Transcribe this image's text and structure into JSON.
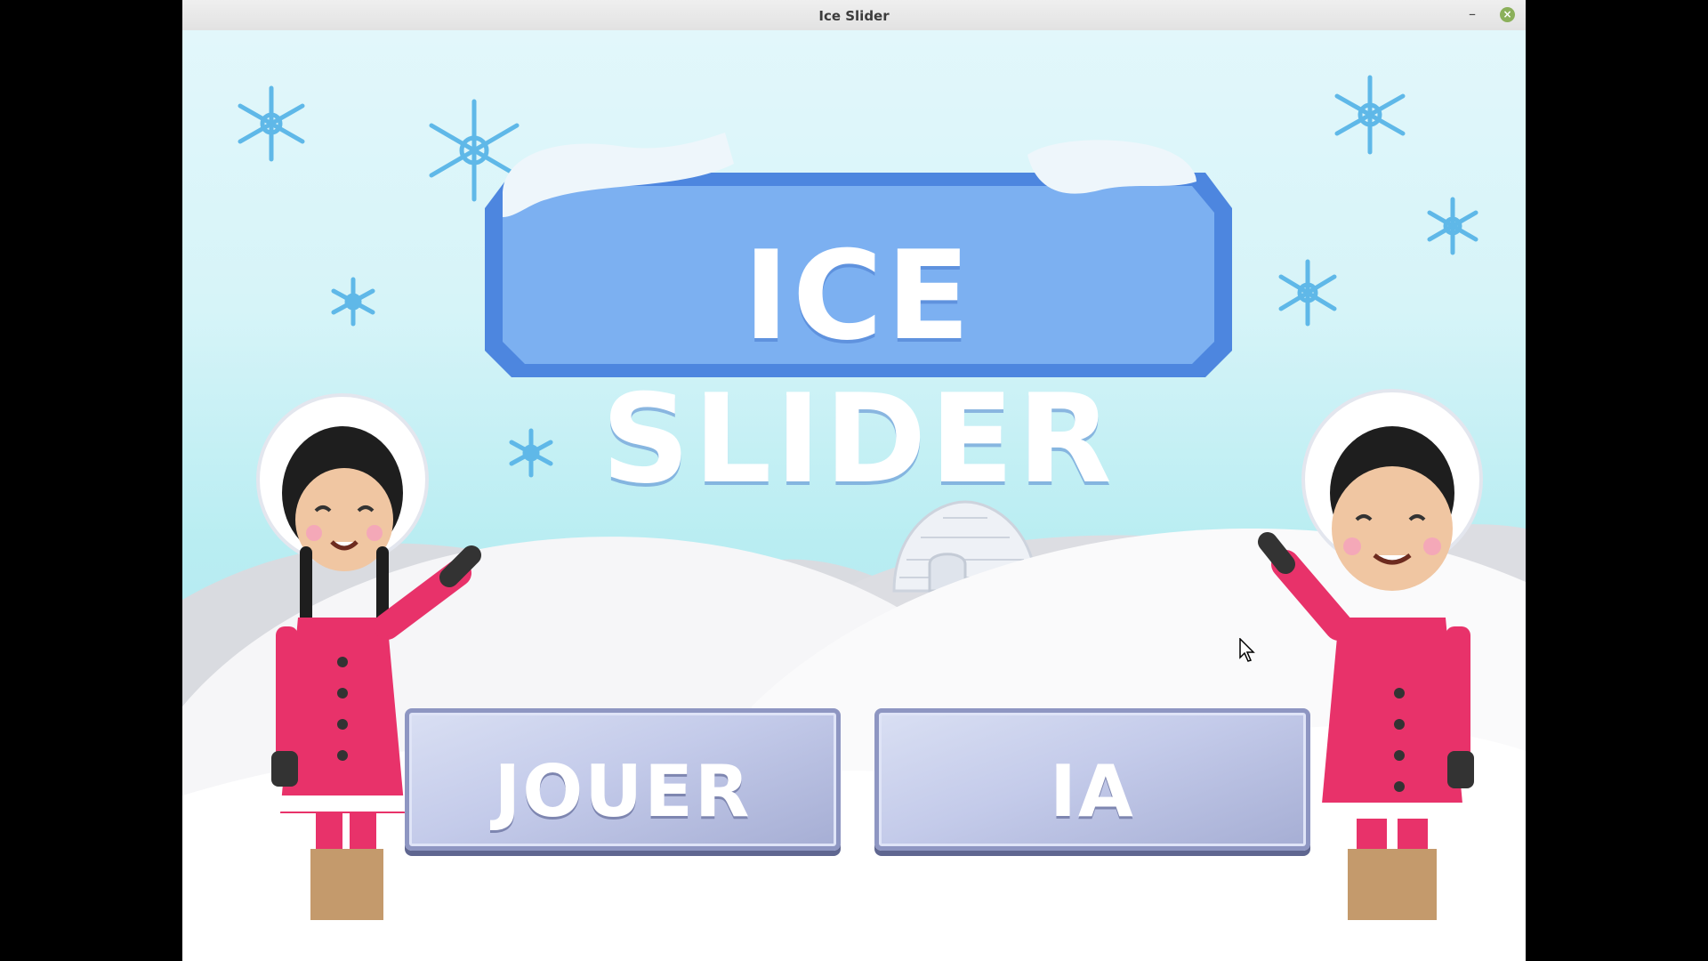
{
  "window": {
    "title": "Ice Slider",
    "minimize_icon": "minimize-icon",
    "close_icon": "close-icon"
  },
  "game": {
    "logo_text": "ICE SLIDER",
    "buttons": [
      {
        "label": "JOUER"
      },
      {
        "label": "IA"
      }
    ]
  },
  "colors": {
    "sky": "#c8f1f5",
    "logo_ice": "#6ea2ec",
    "button": "#c4cbea",
    "coat": "#e8326a",
    "close_button": "#8bb05a"
  }
}
